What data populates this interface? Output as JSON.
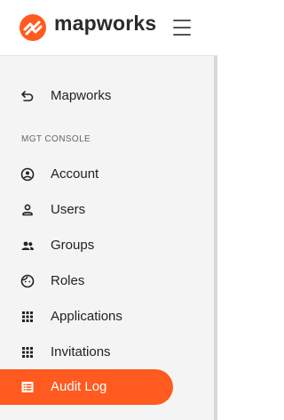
{
  "brand": {
    "name": "mapworks",
    "accent_color": "#ff5a1f"
  },
  "header": {
    "menu_icon": "hamburger-icon"
  },
  "back_link": {
    "label": "Mapworks",
    "icon": "back-arrow-icon"
  },
  "section": {
    "label": "MGT CONSOLE"
  },
  "nav": {
    "items": [
      {
        "label": "Account",
        "icon": "account-circle-icon",
        "active": false
      },
      {
        "label": "Users",
        "icon": "user-icon",
        "active": false
      },
      {
        "label": "Groups",
        "icon": "group-icon",
        "active": false
      },
      {
        "label": "Roles",
        "icon": "face-icon",
        "active": false
      },
      {
        "label": "Applications",
        "icon": "apps-grid-icon",
        "active": false
      },
      {
        "label": "Invitations",
        "icon": "apps-grid-icon",
        "active": false
      },
      {
        "label": "Audit Log",
        "icon": "list-icon",
        "active": true
      }
    ]
  }
}
